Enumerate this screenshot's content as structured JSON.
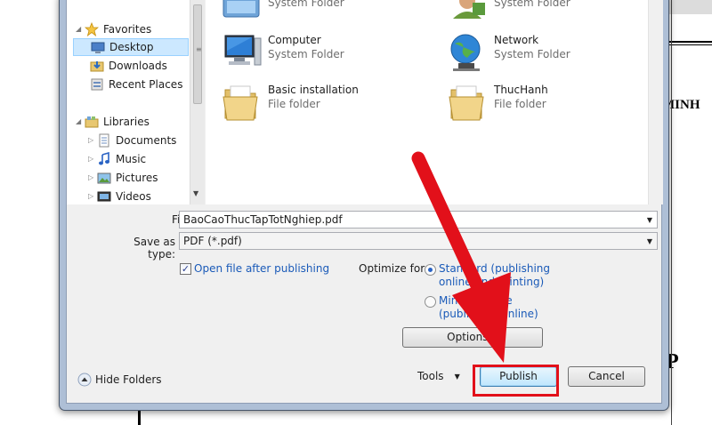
{
  "nav": {
    "favorites": "Favorites",
    "desktop": "Desktop",
    "downloads": "Downloads",
    "recent_places": "Recent Places",
    "libraries": "Libraries",
    "documents": "Documents",
    "music": "Music",
    "pictures": "Pictures",
    "videos": "Videos"
  },
  "files": [
    {
      "name": "",
      "type": "System Folder"
    },
    {
      "name": "",
      "type": "System Folder"
    },
    {
      "name": "Computer",
      "type": "System Folder"
    },
    {
      "name": "Network",
      "type": "System Folder"
    },
    {
      "name": "Basic installation",
      "type": "File folder"
    },
    {
      "name": "ThucHanh",
      "type": "File folder"
    }
  ],
  "form": {
    "file_name_label": "File name:",
    "file_name_value": "BaoCaoThucTapTotNghiep.pdf",
    "save_type_label": "Save as type:",
    "save_type_value": "PDF (*.pdf)",
    "open_after_label": "Open file after publishing",
    "optimize_label": "Optimize for:",
    "standard_line1": "Standard (publishing",
    "standard_line2": "online and printing)",
    "minimum_line1": "Minimum size",
    "minimum_line2": "(publishing online)",
    "options_button": "Options..."
  },
  "footer": {
    "hide_folders": "Hide Folders",
    "tools": "Tools",
    "publish": "Publish",
    "cancel": "Cancel"
  },
  "doc": {
    "text1": "MINH",
    "text2": "P"
  },
  "colors": {
    "highlight": "#e2101a",
    "link": "#1a5ab8"
  }
}
